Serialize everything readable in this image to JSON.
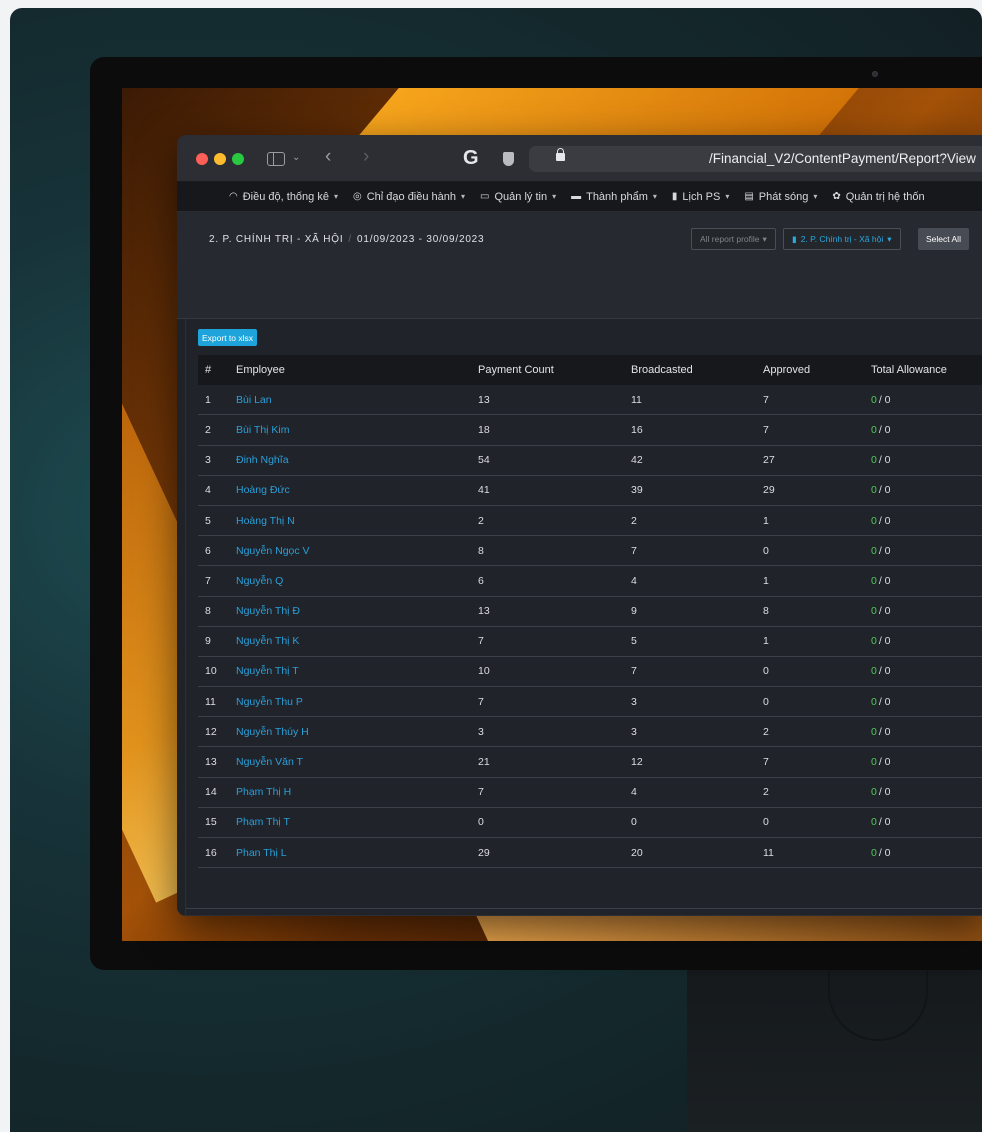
{
  "browser": {
    "url": "/Financial_V2/ContentPayment/Report?View"
  },
  "nav": {
    "items": [
      {
        "icon": "dashboard-icon",
        "label": "Điều độ, thống kê",
        "dropdown": true
      },
      {
        "icon": "globe-icon",
        "label": "Chỉ đạo điều hành",
        "dropdown": true
      },
      {
        "icon": "news-icon",
        "label": "Quản lý tin",
        "dropdown": true
      },
      {
        "icon": "folder-icon",
        "label": "Thành phẩm",
        "dropdown": true
      },
      {
        "icon": "book-icon",
        "label": "Lịch PS",
        "dropdown": true
      },
      {
        "icon": "broadcast-icon",
        "label": "Phát sóng",
        "dropdown": true
      },
      {
        "icon": "gear-icon",
        "label": "Quản trị hệ thốn",
        "dropdown": false
      }
    ]
  },
  "header": {
    "department": "2. P. CHÍNH TRỊ - XÃ HỘI",
    "date_range": "01/09/2023 - 30/09/2023",
    "report_profile": "All report profile",
    "dept_select": "2. P. Chính trị - Xã hội",
    "select_all": "Select All"
  },
  "actions": {
    "export": "Export to xlsx"
  },
  "table": {
    "columns": [
      "#",
      "Employee",
      "Payment Count",
      "Broadcasted",
      "Approved",
      "Total Allowance"
    ],
    "rows": [
      {
        "no": "1",
        "employee": "Bùi Lan",
        "payment": "13",
        "broadcasted": "11",
        "approved": "7",
        "allow_a": "0",
        "allow_b": "/ 0"
      },
      {
        "no": "2",
        "employee": "Bùi Thị Kim",
        "payment": "18",
        "broadcasted": "16",
        "approved": "7",
        "allow_a": "0",
        "allow_b": "/ 0"
      },
      {
        "no": "3",
        "employee": "Đinh Nghĩa",
        "payment": "54",
        "broadcasted": "42",
        "approved": "27",
        "allow_a": "0",
        "allow_b": "/ 0"
      },
      {
        "no": "4",
        "employee": "Hoàng Đức",
        "payment": "41",
        "broadcasted": "39",
        "approved": "29",
        "allow_a": "0",
        "allow_b": "/ 0"
      },
      {
        "no": "5",
        "employee": "Hoàng Thị N",
        "payment": "2",
        "broadcasted": "2",
        "approved": "1",
        "allow_a": "0",
        "allow_b": "/ 0"
      },
      {
        "no": "6",
        "employee": "Nguyễn Ngọc V",
        "payment": "8",
        "broadcasted": "7",
        "approved": "0",
        "allow_a": "0",
        "allow_b": "/ 0"
      },
      {
        "no": "7",
        "employee": "Nguyễn Q",
        "payment": "6",
        "broadcasted": "4",
        "approved": "1",
        "allow_a": "0",
        "allow_b": "/ 0"
      },
      {
        "no": "8",
        "employee": "Nguyễn Thị Đ",
        "payment": "13",
        "broadcasted": "9",
        "approved": "8",
        "allow_a": "0",
        "allow_b": "/ 0"
      },
      {
        "no": "9",
        "employee": "Nguyễn Thị K",
        "payment": "7",
        "broadcasted": "5",
        "approved": "1",
        "allow_a": "0",
        "allow_b": "/ 0"
      },
      {
        "no": "10",
        "employee": "Nguyễn Thị T",
        "payment": "10",
        "broadcasted": "7",
        "approved": "0",
        "allow_a": "0",
        "allow_b": "/ 0"
      },
      {
        "no": "11",
        "employee": "Nguyễn Thu P",
        "payment": "7",
        "broadcasted": "3",
        "approved": "0",
        "allow_a": "0",
        "allow_b": "/ 0"
      },
      {
        "no": "12",
        "employee": "Nguyễn Thúy H",
        "payment": "3",
        "broadcasted": "3",
        "approved": "2",
        "allow_a": "0",
        "allow_b": "/ 0"
      },
      {
        "no": "13",
        "employee": "Nguyễn Văn T",
        "payment": "21",
        "broadcasted": "12",
        "approved": "7",
        "allow_a": "0",
        "allow_b": "/ 0"
      },
      {
        "no": "14",
        "employee": "Phạm Thị H",
        "payment": "7",
        "broadcasted": "4",
        "approved": "2",
        "allow_a": "0",
        "allow_b": "/ 0"
      },
      {
        "no": "15",
        "employee": "Phạm Thị T",
        "payment": "0",
        "broadcasted": "0",
        "approved": "0",
        "allow_a": "0",
        "allow_b": "/ 0"
      },
      {
        "no": "16",
        "employee": "Phan Thị L",
        "payment": "29",
        "broadcasted": "20",
        "approved": "11",
        "allow_a": "0",
        "allow_b": "/ 0"
      }
    ]
  },
  "colors": {
    "accent": "#1ea3db",
    "link": "#2a9fd8",
    "allowance_zero": "#4ecb55"
  }
}
